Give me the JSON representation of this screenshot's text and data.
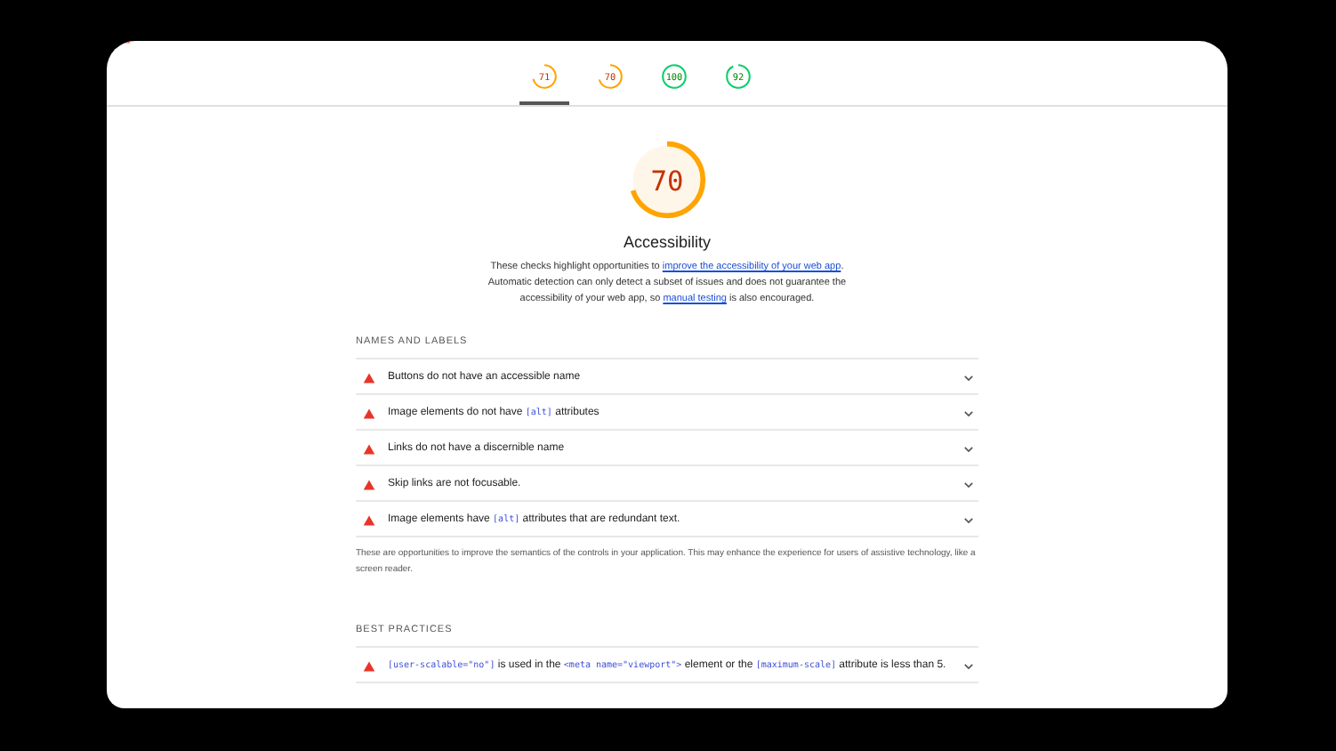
{
  "tabs": [
    {
      "score": "71",
      "color": "#ffa400",
      "selected": true
    },
    {
      "score": "70",
      "color": "#ffa400",
      "selected": false
    },
    {
      "score": "100",
      "color": "#0cce6b",
      "selected": false
    },
    {
      "score": "92",
      "color": "#0cce6b",
      "selected": false
    }
  ],
  "category": {
    "score": "70",
    "color": "#ffa400",
    "title": "Accessibility",
    "description": [
      {
        "kind": "text",
        "text": "These checks highlight opportunities to "
      },
      {
        "kind": "link",
        "text": "improve the accessibility of your web app"
      },
      {
        "kind": "text",
        "text": ". Automatic detection can only detect a subset of issues and does not guarantee the accessibility of your web app, so "
      },
      {
        "kind": "link",
        "text": "manual testing"
      },
      {
        "kind": "text",
        "text": " is also encouraged."
      }
    ]
  },
  "groups": [
    {
      "title": "NAMES AND LABELS",
      "audits": [
        {
          "parts": [
            {
              "kind": "text",
              "text": "Buttons do not have an accessible name"
            }
          ]
        },
        {
          "parts": [
            {
              "kind": "text",
              "text": "Image elements do not have "
            },
            {
              "kind": "code",
              "text": "[alt]"
            },
            {
              "kind": "text",
              "text": " attributes"
            }
          ]
        },
        {
          "parts": [
            {
              "kind": "text",
              "text": "Links do not have a discernible name"
            }
          ]
        },
        {
          "parts": [
            {
              "kind": "text",
              "text": "Skip links are not focusable."
            }
          ]
        },
        {
          "parts": [
            {
              "kind": "text",
              "text": "Image elements have "
            },
            {
              "kind": "code",
              "text": "[alt]"
            },
            {
              "kind": "text",
              "text": " attributes that are redundant text."
            }
          ]
        }
      ],
      "description": "These are opportunities to improve the semantics of the controls in your application. This may enhance the experience for users of assistive technology, like a screen reader."
    },
    {
      "title": "BEST PRACTICES",
      "audits": [
        {
          "parts": [
            {
              "kind": "code",
              "text": "[user-scalable=\"no\"]"
            },
            {
              "kind": "text",
              "text": " is used in the "
            },
            {
              "kind": "code",
              "text": "<meta name=\"viewport\">"
            },
            {
              "kind": "text",
              "text": " element or the "
            },
            {
              "kind": "code",
              "text": "[maximum-scale]"
            },
            {
              "kind": "text",
              "text": " attribute is less than 5."
            }
          ]
        }
      ]
    }
  ]
}
